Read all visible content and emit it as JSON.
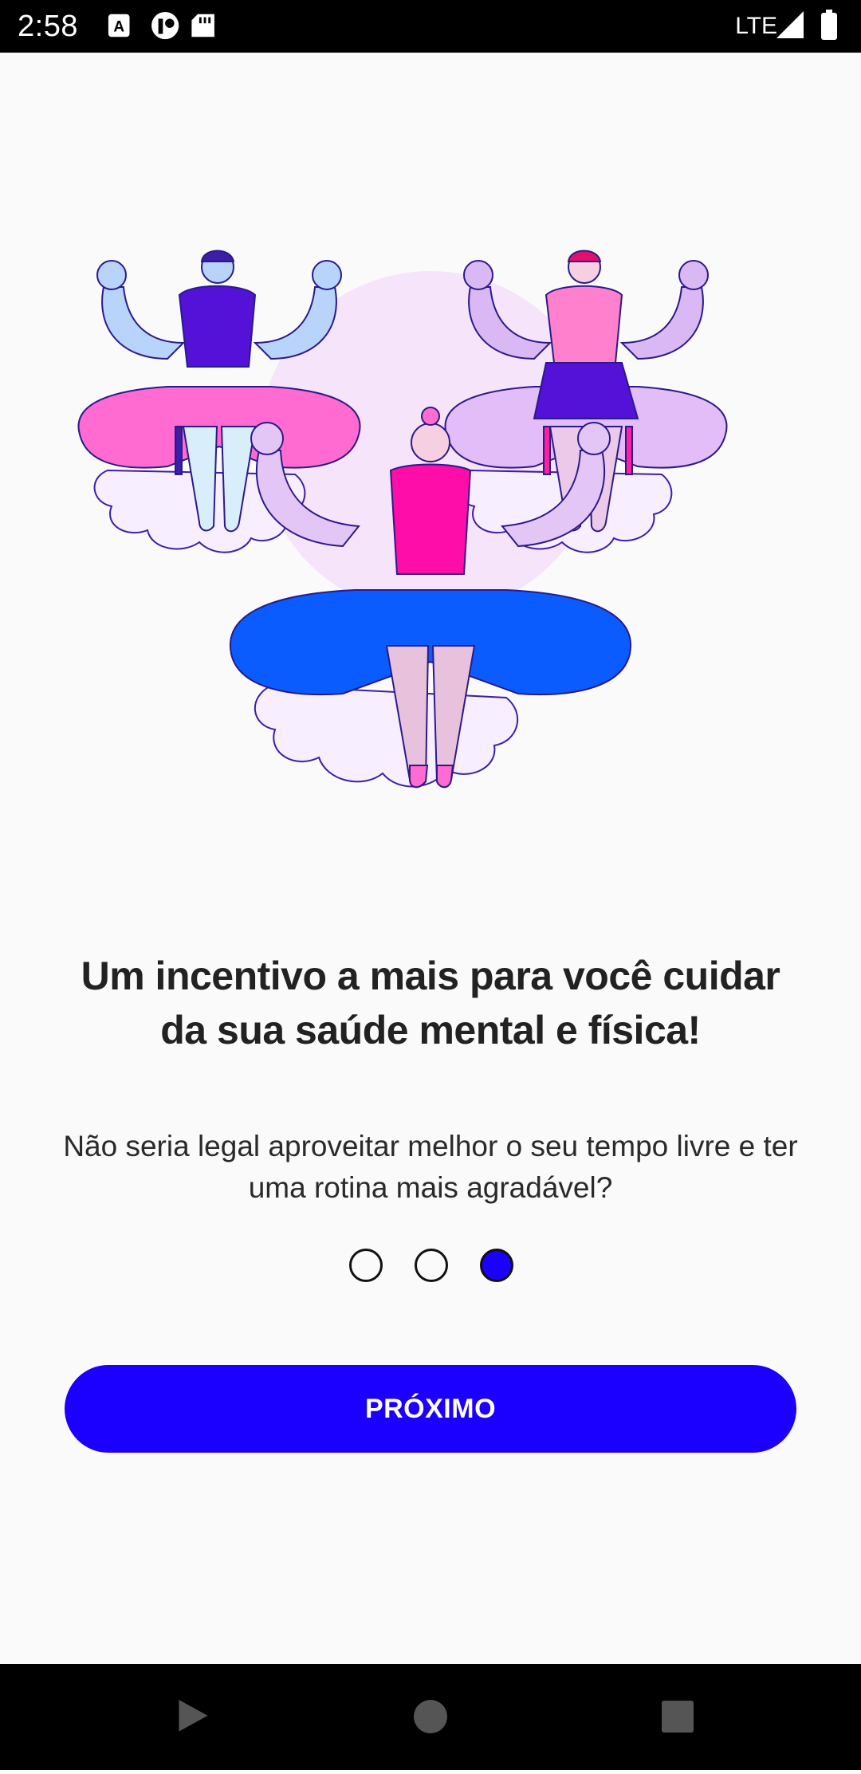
{
  "status_bar": {
    "time": "2:58",
    "network": "LTE",
    "left_icons": [
      "keyboard-a-icon",
      "app-notification-icon",
      "sd-card-icon"
    ],
    "right_icons": [
      "signal-icon",
      "battery-icon"
    ]
  },
  "illustration": {
    "icon": "meditation-illustration",
    "colors": {
      "primary": "#1b00ff",
      "pink": "#ff6bd0",
      "lavender": "#e3c6f6",
      "blue": "#0a5cff",
      "cloud": "#f7eeff"
    }
  },
  "onboarding": {
    "headline_line1": "Um incentivo a mais para você cuidar",
    "headline_line2": "da sua saúde mental e física!",
    "subtext_line1": "Não seria legal aproveitar melhor o seu tempo livre e ter",
    "subtext_line2": "uma rotina mais agradável?",
    "pager": {
      "total": 3,
      "active": 3
    },
    "next_button_label": "PRÓXIMO"
  },
  "navigation_bar": {
    "buttons": [
      "back-icon",
      "home-icon",
      "recents-icon"
    ]
  }
}
